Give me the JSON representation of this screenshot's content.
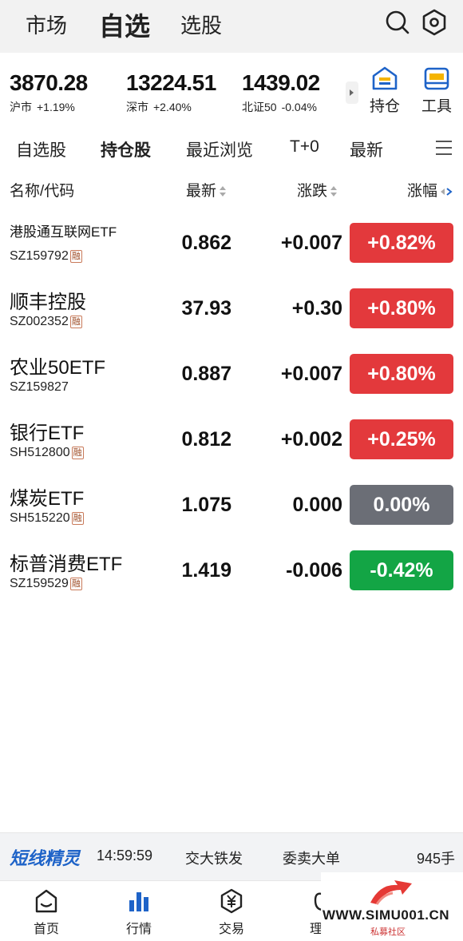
{
  "top_nav": {
    "tabs": [
      "市场",
      "自选",
      "选股"
    ],
    "active_tab": "自选",
    "search_icon": "search-icon",
    "settings_icon": "hexagon-settings-icon"
  },
  "indices": [
    {
      "value": "3870.28",
      "name": "沪市",
      "change": "+1.19%"
    },
    {
      "value": "13224.51",
      "name": "深市",
      "change": "+2.40%"
    },
    {
      "value": "1439.02",
      "name": "北证50",
      "change": "-0.04%"
    }
  ],
  "tools": [
    {
      "label": "持仓",
      "icon": "house-holding-icon"
    },
    {
      "label": "工具",
      "icon": "toolbox-icon"
    }
  ],
  "sub_tabs": [
    "自选股",
    "持仓股",
    "最近浏览",
    "T+0",
    "最新"
  ],
  "active_sub_tab": "持仓股",
  "table": {
    "headers": {
      "name": "名称/代码",
      "price": "最新",
      "change": "涨跌",
      "pct": "涨幅"
    },
    "rows": [
      {
        "name": "港股通互联网ETF",
        "code": "SZ159792",
        "rong": "融",
        "price": "0.862",
        "change": "+0.007",
        "pct": "+0.82%",
        "trend": "up"
      },
      {
        "name": "顺丰控股",
        "code": "SZ002352",
        "rong": "融",
        "price": "37.93",
        "change": "+0.30",
        "pct": "+0.80%",
        "trend": "up"
      },
      {
        "name": "农业50ETF",
        "code": "SZ159827",
        "rong": "",
        "price": "0.887",
        "change": "+0.007",
        "pct": "+0.80%",
        "trend": "up"
      },
      {
        "name": "银行ETF",
        "code": "SH512800",
        "rong": "融",
        "price": "0.812",
        "change": "+0.002",
        "pct": "+0.25%",
        "trend": "up"
      },
      {
        "name": "煤炭ETF",
        "code": "SH515220",
        "rong": "融",
        "price": "1.075",
        "change": "0.000",
        "pct": "0.00%",
        "trend": "flat"
      },
      {
        "name": "标普消费ETF",
        "code": "SZ159529",
        "rong": "融",
        "price": "1.419",
        "change": "-0.006",
        "pct": "-0.42%",
        "trend": "down"
      }
    ]
  },
  "ticker": {
    "logo": "短线精灵",
    "time": "14:59:59",
    "stock": "交大铁发",
    "event": "委卖大单",
    "volume": "945手"
  },
  "bottom_nav": [
    {
      "label": "首页",
      "icon": "home-icon"
    },
    {
      "label": "行情",
      "icon": "bar-chart-icon"
    },
    {
      "label": "交易",
      "icon": "yuan-shield-icon"
    },
    {
      "label": "理",
      "icon": "wealth-icon"
    }
  ],
  "watermark": {
    "text": "WWW.SIMU001.CN",
    "sub": "私募社区"
  },
  "colors": {
    "up": "#e3393c",
    "flat": "#6b6e76",
    "down": "#13a545",
    "accent": "#1e63c8"
  }
}
